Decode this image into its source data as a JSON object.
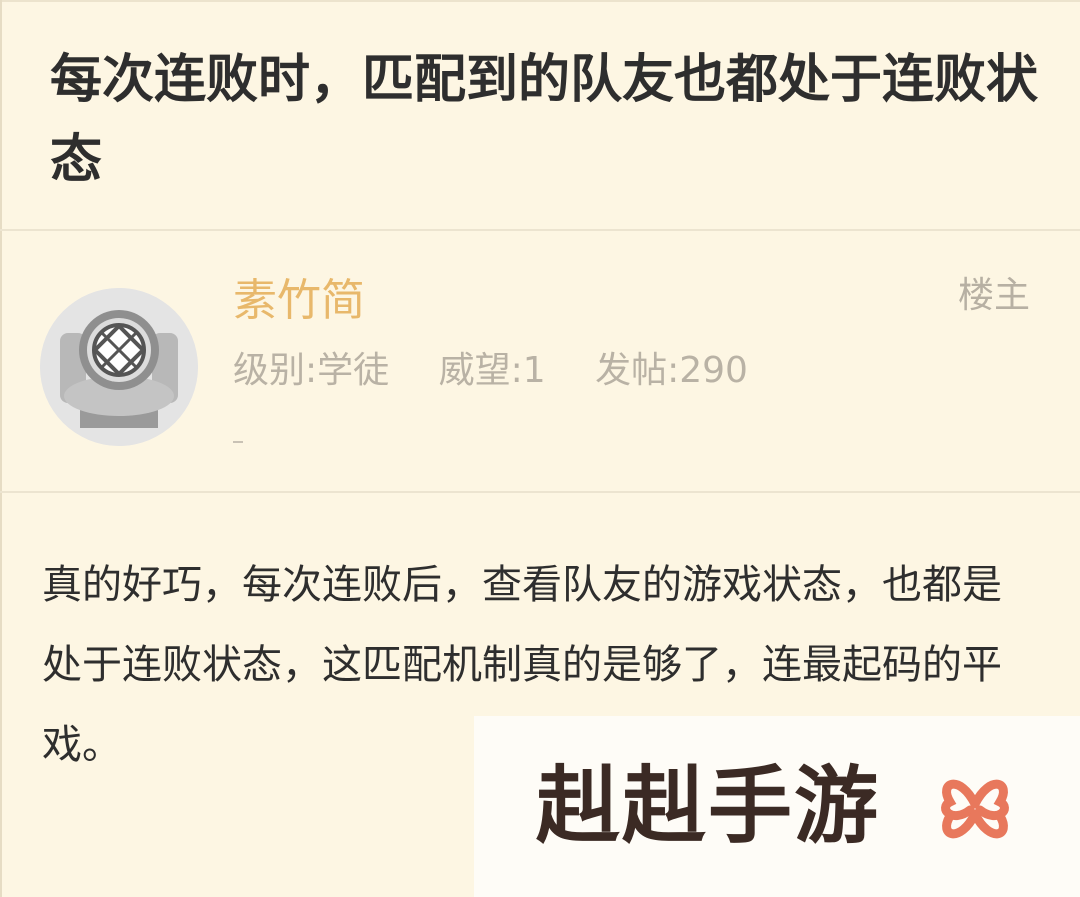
{
  "thread": {
    "title": "每次连败时，匹配到的队友也都处于连败状态"
  },
  "author": {
    "name": "素竹简",
    "badge": "楼主",
    "level": "级别:学徒",
    "prestige": "威望:1",
    "posts": "发帖:290",
    "avatar_icon": "diver-helmet-icon"
  },
  "post": {
    "body": "真的好巧，每次连败后，查看队友的游戏状态，也都是处于连败状态，这匹配机制真的是够了，连最起码的平戏。"
  },
  "watermark": {
    "text": "赳赳手游",
    "logo_icon": "flower-logo-icon"
  },
  "colors": {
    "background": "#fdf6e3",
    "author_name": "#e8b86b",
    "muted": "#b9b2a5",
    "title": "#2e2e2e",
    "logo": "#e8785c"
  }
}
